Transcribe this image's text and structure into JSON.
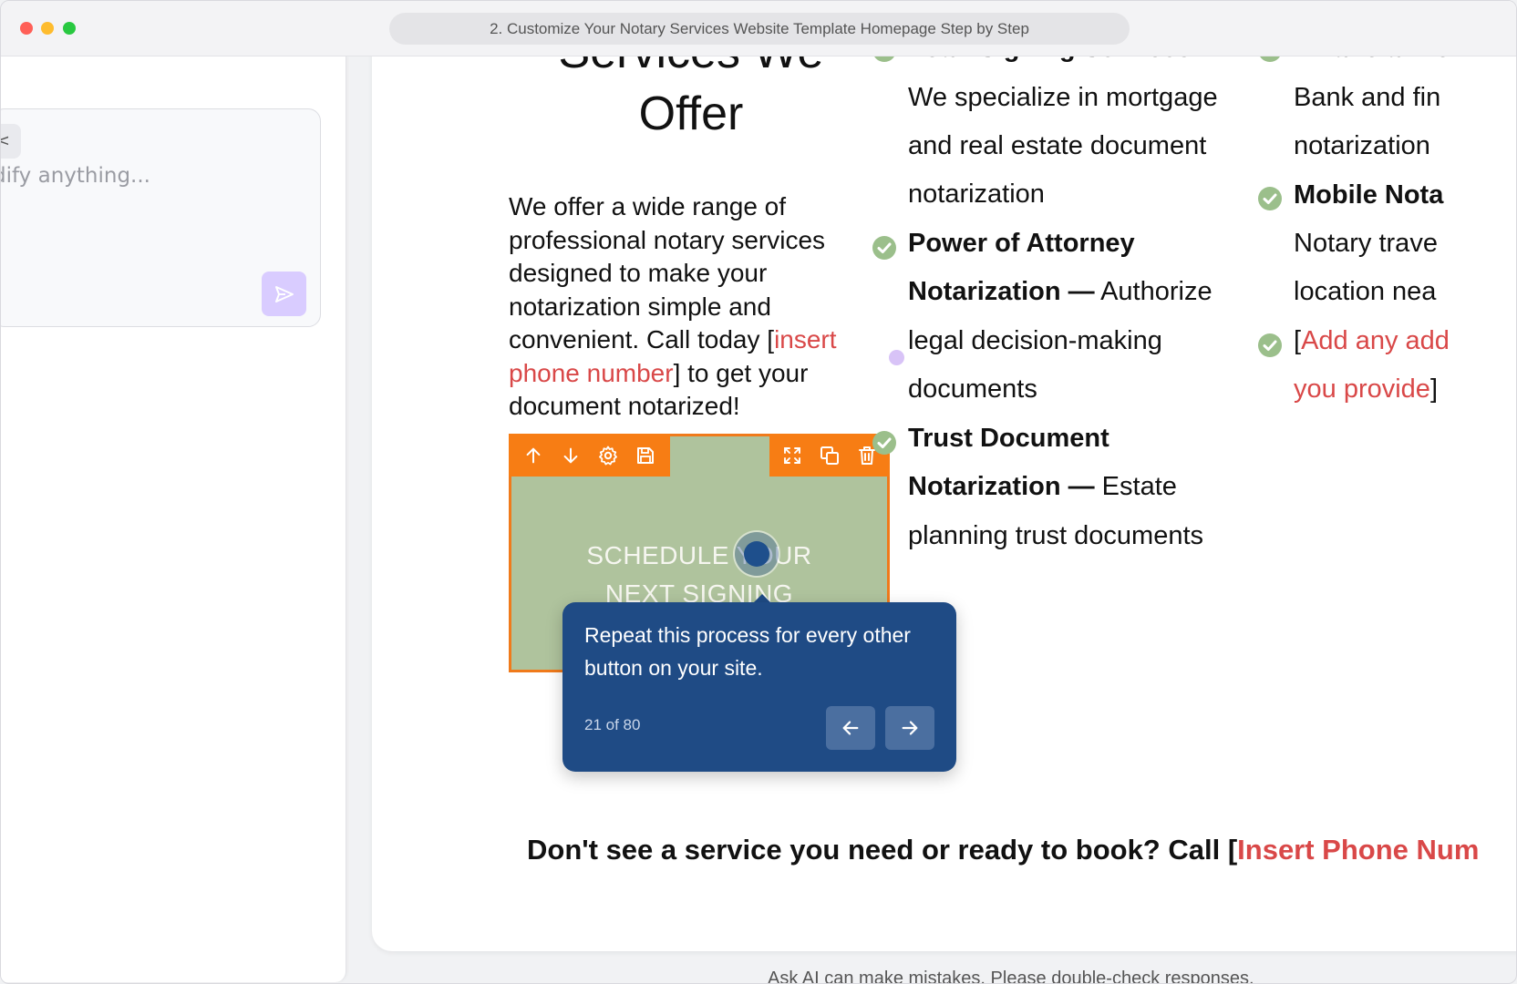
{
  "window": {
    "title": "2. Customize Your Notary Services Website Template Homepage Step by Step"
  },
  "left_panel": {
    "chip_text": "<",
    "prompt_placeholder": "dify anything..."
  },
  "page": {
    "heading_line1": "Services We",
    "heading_line2": "Offer",
    "intro_part1": "We offer a wide range of professional notary services designed to make your notarization simple and convenient. Call today [",
    "intro_red": "insert phone number",
    "intro_part2": "] to get your document notarized!",
    "button_line1": "SCHEDULE YOUR",
    "button_line2": "NEXT SIGNING",
    "services_col1": {
      "item1_title_cut": "Loan Signing Services",
      "item1_desc": [
        "We specialize in mortgage",
        "and real estate document",
        "notarization"
      ],
      "item2_title_a": "Power of Attorney",
      "item2_title_b": "Notarization —",
      "item2_desc_inline": " Authorize",
      "item2_desc": [
        "legal decision-making",
        "documents"
      ],
      "item3_title_a": "Trust Document",
      "item3_title_b": "Notarization —",
      "item3_desc_inline": " Estate",
      "item3_desc": [
        "planning trust documents"
      ]
    },
    "services_col2": {
      "item1_title_cut": "Financial Do",
      "item1_desc": [
        "Bank and fin",
        "notarization"
      ],
      "item2_title": "Mobile Nota",
      "item2_desc": [
        "Notary trave",
        "location nea"
      ],
      "item3_prefix": "[",
      "item3_red_a": "Add any add",
      "item3_red_b": "you provide",
      "item3_suffix": "]"
    },
    "cta_text": "Don't see a service you need or ready to book? Call [",
    "cta_red": "Insert Phone Num"
  },
  "tooltip": {
    "text": "Repeat this process for every other button on your site.",
    "counter": "21 of 80"
  },
  "footer_note": "Ask AI can make mistakes. Please double-check responses.",
  "colors": {
    "accent_orange": "#f77d14",
    "tooltip_blue": "#1f4b85",
    "check_green": "#9bbf8b",
    "placeholder_red": "#d94848"
  }
}
